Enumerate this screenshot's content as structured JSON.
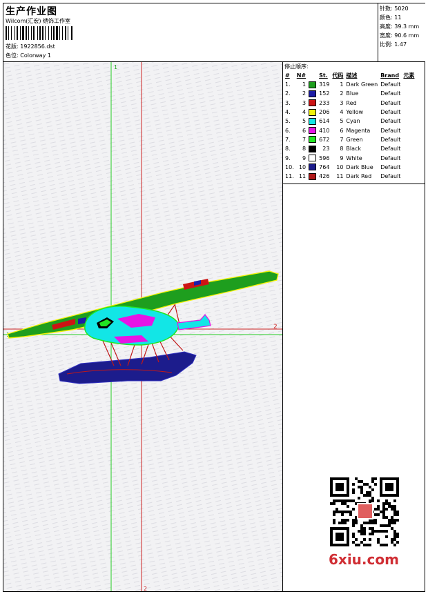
{
  "header": {
    "title": "生产作业图",
    "company": "Wilcom(汇宏) 绣饰工作室",
    "design_label": "花版: 1922856.dst",
    "colorway_label": "色位: Colorway 1"
  },
  "stats": {
    "stitches": "针数: 5020",
    "colors": "颜色: 11",
    "height": "高度: 39.3 mm",
    "width": "宽度: 90.6 mm",
    "scale": "比例: 1.47"
  },
  "sequence": {
    "title": "停止顺序:",
    "headers": [
      "#",
      "N#",
      "St.",
      "代码",
      "描述",
      "Brand",
      "元素"
    ],
    "rows": [
      {
        "idx": "1.",
        "n": "1",
        "color": "#1e9e1e",
        "st": "319",
        "code": "1",
        "desc": "Dark Green",
        "brand": "Default"
      },
      {
        "idx": "2.",
        "n": "2",
        "color": "#1c1ca6",
        "st": "152",
        "code": "2",
        "desc": "Blue",
        "brand": "Default"
      },
      {
        "idx": "3.",
        "n": "3",
        "color": "#cc1414",
        "st": "233",
        "code": "3",
        "desc": "Red",
        "brand": "Default"
      },
      {
        "idx": "4.",
        "n": "4",
        "color": "#f2f20a",
        "st": "206",
        "code": "4",
        "desc": "Yellow",
        "brand": "Default"
      },
      {
        "idx": "5.",
        "n": "5",
        "color": "#12e6e6",
        "st": "614",
        "code": "5",
        "desc": "Cyan",
        "brand": "Default"
      },
      {
        "idx": "6.",
        "n": "6",
        "color": "#e614e6",
        "st": "410",
        "code": "6",
        "desc": "Magenta",
        "brand": "Default"
      },
      {
        "idx": "7.",
        "n": "7",
        "color": "#22e622",
        "st": "672",
        "code": "7",
        "desc": "Green",
        "brand": "Default"
      },
      {
        "idx": "8.",
        "n": "8",
        "color": "#000000",
        "st": "23",
        "code": "8",
        "desc": "Black",
        "brand": "Default"
      },
      {
        "idx": "9.",
        "n": "9",
        "color": "#ffffff",
        "st": "596",
        "code": "9",
        "desc": "White",
        "brand": "Default"
      },
      {
        "idx": "10.",
        "n": "10",
        "color": "#1c1c8c",
        "st": "764",
        "code": "10",
        "desc": "Dark Blue",
        "brand": "Default"
      },
      {
        "idx": "11.",
        "n": "11",
        "color": "#b01818",
        "st": "426",
        "code": "11",
        "desc": "Dark Red",
        "brand": "Default"
      }
    ]
  },
  "guides": {
    "v1": "1",
    "v2": "2",
    "h2": "2",
    "h1": "1"
  },
  "watermark": {
    "logo": "6xiu.com"
  }
}
